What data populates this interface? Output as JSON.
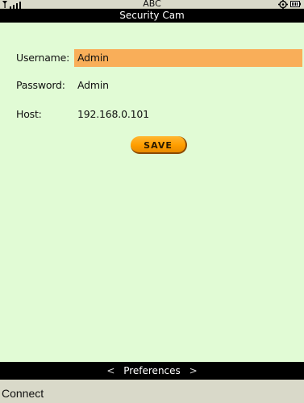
{
  "status_bar": {
    "carrier": "ABC",
    "signal_icon": "signal-strength-icon",
    "settings_icon": "gear-icon",
    "battery_icon": "battery-icon"
  },
  "title": "Security Cam",
  "form": {
    "username_label": "Username:",
    "username_value": "Admin",
    "password_label": "Password:",
    "password_value": "Admin",
    "host_label": "Host:",
    "host_value": "192.168.0.101"
  },
  "save_label": "SAVE",
  "nav": {
    "prev_arrow": "<",
    "label": "Preferences",
    "next_arrow": ">"
  },
  "softkey": {
    "left_label": "Connect"
  },
  "colors": {
    "background": "#e1fbd5",
    "highlight": "#f9ae59",
    "button": "#ff9e00",
    "bars": "#000000",
    "chrome": "#d9d9c9"
  }
}
